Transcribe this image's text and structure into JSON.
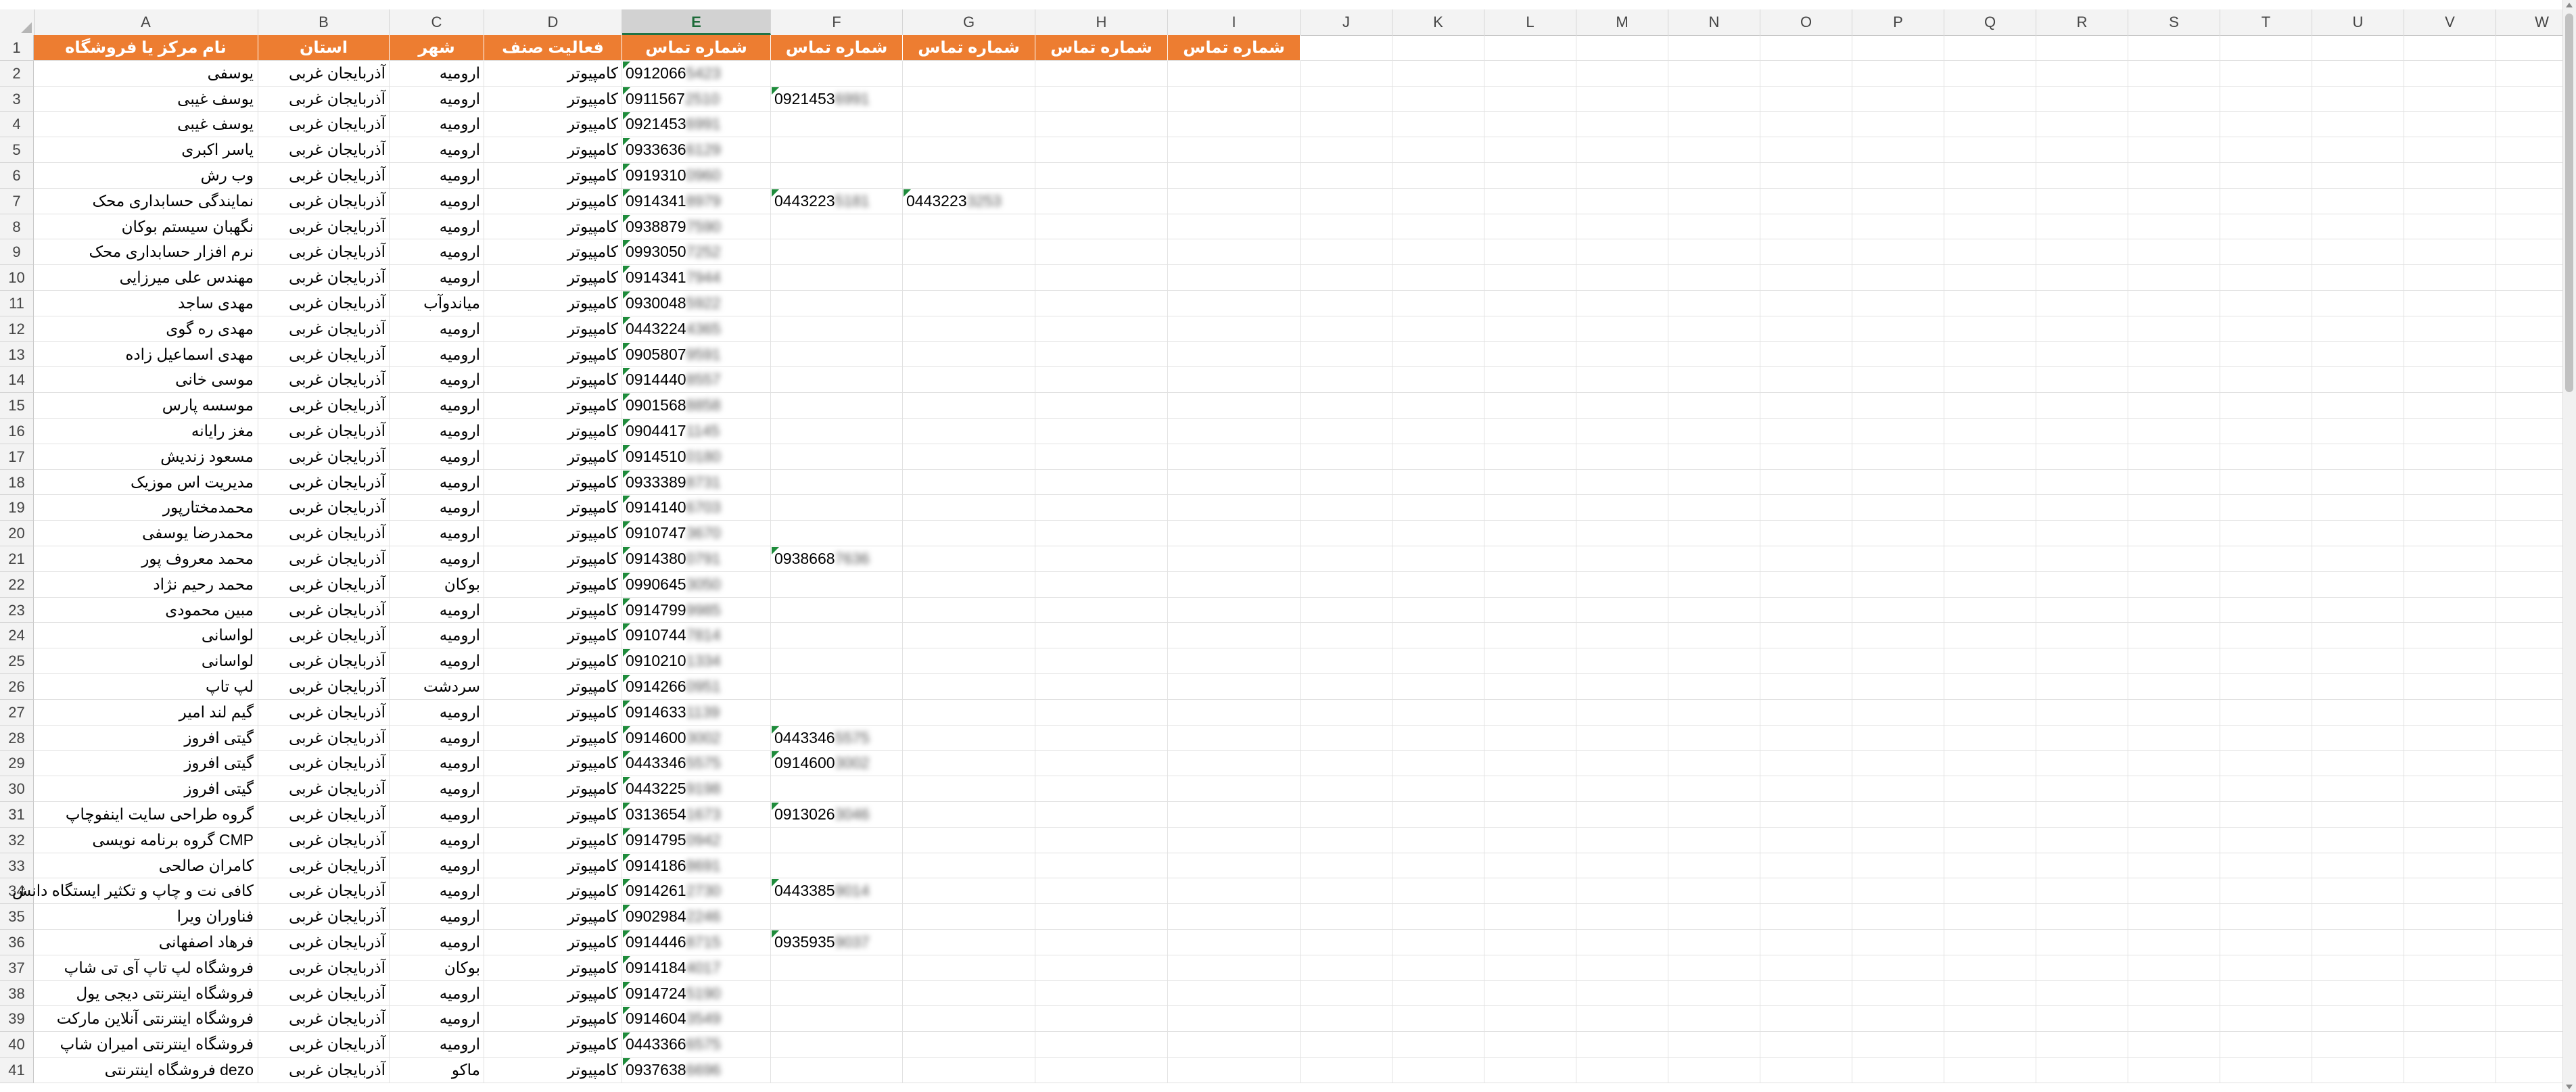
{
  "columns": [
    "A",
    "B",
    "C",
    "D",
    "E",
    "F",
    "G",
    "H",
    "I",
    "J",
    "K",
    "L",
    "M",
    "N",
    "O",
    "P",
    "Q",
    "R",
    "S",
    "T",
    "U",
    "V",
    "W"
  ],
  "selected_column": "E",
  "header_row": {
    "A": "نام مرکز یا فروشگاه",
    "B": "استان",
    "C": "شهر",
    "D": "فعالیت صنف",
    "E": "شماره تماس",
    "F": "شماره تماس",
    "G": "شماره تماس",
    "H": "شماره تماس",
    "I": "شماره تماس"
  },
  "rows": [
    {
      "n": "2",
      "A": "یوسفی",
      "B": "آذربایجان غربی",
      "C": "ارومیه",
      "D": "کامپیوتر",
      "E": "0912066",
      "Eb": "5423"
    },
    {
      "n": "3",
      "A": "یوسف غیبی",
      "B": "آذربایجان غربی",
      "C": "ارومیه",
      "D": "کامپیوتر",
      "E": "0911567",
      "Eb": "2510",
      "F": "0921453",
      "Fb": "6991"
    },
    {
      "n": "4",
      "A": "یوسف غیبی",
      "B": "آذربایجان غربی",
      "C": "ارومیه",
      "D": "کامپیوتر",
      "E": "0921453",
      "Eb": "6991"
    },
    {
      "n": "5",
      "A": "یاسر اکبری",
      "B": "آذربایجان غربی",
      "C": "ارومیه",
      "D": "کامپیوتر",
      "E": "0933636",
      "Eb": "6129"
    },
    {
      "n": "6",
      "A": "وب رش",
      "B": "آذربایجان غربی",
      "C": "ارومیه",
      "D": "کامپیوتر",
      "E": "0919310",
      "Eb": "0960"
    },
    {
      "n": "7",
      "A": "نمایندگی حسابداری محک",
      "B": "آذربایجان غربی",
      "C": "ارومیه",
      "D": "کامپیوتر",
      "E": "0914341",
      "Eb": "8979",
      "F": "0443223",
      "Fb": "5181",
      "G": "0443223",
      "Gb": "3253"
    },
    {
      "n": "8",
      "A": "نگهبان سیستم بوکان",
      "B": "آذربایجان غربی",
      "C": "ارومیه",
      "D": "کامپیوتر",
      "E": "0938879",
      "Eb": "7590"
    },
    {
      "n": "9",
      "A": "نرم افزار حسابداری محک",
      "B": "آذربایجان غربی",
      "C": "ارومیه",
      "D": "کامپیوتر",
      "E": "0993050",
      "Eb": "7252"
    },
    {
      "n": "10",
      "A": "مهندس علی میرزایی",
      "B": "آذربایجان غربی",
      "C": "ارومیه",
      "D": "کامپیوتر",
      "E": "0914341",
      "Eb": "7944"
    },
    {
      "n": "11",
      "A": "مهدی ساجد",
      "B": "آذربایجان غربی",
      "C": "میاندوآب",
      "D": "کامپیوتر",
      "E": "0930048",
      "Eb": "5922"
    },
    {
      "n": "12",
      "A": "مهدی ره گوی",
      "B": "آذربایجان غربی",
      "C": "ارومیه",
      "D": "کامپیوتر",
      "E": "0443224",
      "Eb": "4365"
    },
    {
      "n": "13",
      "A": "مهدی اسماعیل زاده",
      "B": "آذربایجان غربی",
      "C": "ارومیه",
      "D": "کامپیوتر",
      "E": "0905807",
      "Eb": "9591"
    },
    {
      "n": "14",
      "A": "موسی خانی",
      "B": "آذربایجان غربی",
      "C": "ارومیه",
      "D": "کامپیوتر",
      "E": "0914440",
      "Eb": "8557"
    },
    {
      "n": "15",
      "A": "موسسه پارس",
      "B": "آذربایجان غربی",
      "C": "ارومیه",
      "D": "کامپیوتر",
      "E": "0901568",
      "Eb": "8858"
    },
    {
      "n": "16",
      "A": "مغز رایانه",
      "B": "آذربایجان غربی",
      "C": "ارومیه",
      "D": "کامپیوتر",
      "E": "0904417",
      "Eb": "1145"
    },
    {
      "n": "17",
      "A": "مسعود زندیش",
      "B": "آذربایجان غربی",
      "C": "ارومیه",
      "D": "کامپیوتر",
      "E": "0914510",
      "Eb": "0180"
    },
    {
      "n": "18",
      "A": "مدیریت اس موزیک",
      "B": "آذربایجان غربی",
      "C": "ارومیه",
      "D": "کامپیوتر",
      "E": "0933389",
      "Eb": "8731"
    },
    {
      "n": "19",
      "A": "محمدمختارپور",
      "B": "آذربایجان غربی",
      "C": "ارومیه",
      "D": "کامپیوتر",
      "E": "0914140",
      "Eb": "6703"
    },
    {
      "n": "20",
      "A": "محمدرضا یوسفی",
      "B": "آذربایجان غربی",
      "C": "ارومیه",
      "D": "کامپیوتر",
      "E": "0910747",
      "Eb": "3670"
    },
    {
      "n": "21",
      "A": "محمد معروف پور",
      "B": "آذربایجان غربی",
      "C": "ارومیه",
      "D": "کامپیوتر",
      "E": "0914380",
      "Eb": "0791",
      "F": "0938668",
      "Fb": "7636"
    },
    {
      "n": "22",
      "A": "محمد رحیم نژاد",
      "B": "آذربایجان غربی",
      "C": "بوکان",
      "D": "کامپیوتر",
      "E": "0990645",
      "Eb": "3050"
    },
    {
      "n": "23",
      "A": "مبین محمودی",
      "B": "آذربایجان غربی",
      "C": "ارومیه",
      "D": "کامپیوتر",
      "E": "0914799",
      "Eb": "9985"
    },
    {
      "n": "24",
      "A": "لواسانی",
      "B": "آذربایجان غربی",
      "C": "ارومیه",
      "D": "کامپیوتر",
      "E": "0910744",
      "Eb": "7814"
    },
    {
      "n": "25",
      "A": "لواسانی",
      "B": "آذربایجان غربی",
      "C": "ارومیه",
      "D": "کامپیوتر",
      "E": "0910210",
      "Eb": "1334"
    },
    {
      "n": "26",
      "A": "لپ تاپ",
      "B": "آذربایجان غربی",
      "C": "سردشت",
      "D": "کامپیوتر",
      "E": "0914266",
      "Eb": "0951"
    },
    {
      "n": "27",
      "A": "گیم لند امیر",
      "B": "آذربایجان غربی",
      "C": "ارومیه",
      "D": "کامپیوتر",
      "E": "0914633",
      "Eb": "1139"
    },
    {
      "n": "28",
      "A": "گیتی افروز",
      "B": "آذربایجان غربی",
      "C": "ارومیه",
      "D": "کامپیوتر",
      "E": "0914600",
      "Eb": "3002",
      "F": "0443346",
      "Fb": "5575"
    },
    {
      "n": "29",
      "A": "گیتی افروز",
      "B": "آذربایجان غربی",
      "C": "ارومیه",
      "D": "کامپیوتر",
      "E": "0443346",
      "Eb": "5575",
      "F": "0914600",
      "Fb": "3002"
    },
    {
      "n": "30",
      "A": "گیتی افروز",
      "B": "آذربایجان غربی",
      "C": "ارومیه",
      "D": "کامپیوتر",
      "E": "0443225",
      "Eb": "9198"
    },
    {
      "n": "31",
      "A": "گروه طراحی سایت اینفوچاپ",
      "B": "آذربایجان غربی",
      "C": "ارومیه",
      "D": "کامپیوتر",
      "E": "0313654",
      "Eb": "1673",
      "F": "0913026",
      "Fb": "3046"
    },
    {
      "n": "32",
      "A": "گروه برنامه نویسی CMP",
      "B": "آذربایجان غربی",
      "C": "ارومیه",
      "D": "کامپیوتر",
      "E": "0914795",
      "Eb": "0942"
    },
    {
      "n": "33",
      "A": "کامران صالحی",
      "B": "آذربایجان غربی",
      "C": "ارومیه",
      "D": "کامپیوتر",
      "E": "0914186",
      "Eb": "8691"
    },
    {
      "n": "34",
      "A": "کافی نت و چاپ و تکثیر ایستگاه دانش",
      "B": "آذربایجان غربی",
      "C": "ارومیه",
      "D": "کامپیوتر",
      "E": "0914261",
      "Eb": "2730",
      "F": "0443385",
      "Fb": "9014"
    },
    {
      "n": "35",
      "A": "فناوران ویرا",
      "B": "آذربایجان غربی",
      "C": "ارومیه",
      "D": "کامپیوتر",
      "E": "0902984",
      "Eb": "2246"
    },
    {
      "n": "36",
      "A": "فرهاد اصفهانی",
      "B": "آذربایجان غربی",
      "C": "ارومیه",
      "D": "کامپیوتر",
      "E": "0914446",
      "Eb": "8715",
      "F": "0935935",
      "Fb": "9037"
    },
    {
      "n": "37",
      "A": "فروشگاه لپ تاپ آی تی شاپ",
      "B": "آذربایجان غربی",
      "C": "بوکان",
      "D": "کامپیوتر",
      "E": "0914184",
      "Eb": "4017"
    },
    {
      "n": "38",
      "A": "فروشگاه اینترنتی دیجی یول",
      "B": "آذربایجان غربی",
      "C": "ارومیه",
      "D": "کامپیوتر",
      "E": "0914724",
      "Eb": "5190"
    },
    {
      "n": "39",
      "A": "فروشگاه اینترنتی آنلاین مارکت",
      "B": "آذربایجان غربی",
      "C": "ارومیه",
      "D": "کامپیوتر",
      "E": "0914604",
      "Eb": "3549"
    },
    {
      "n": "40",
      "A": "فروشگاه اینترنتی امیران شاپ",
      "B": "آذربایجان غربی",
      "C": "ارومیه",
      "D": "کامپیوتر",
      "E": "0443366",
      "Eb": "6575"
    },
    {
      "n": "41",
      "A": "فروشگاه اینترنتی dezo",
      "B": "آذربایجان غربی",
      "C": "ماکو",
      "D": "کامپیوتر",
      "E": "0937638",
      "Eb": "6696"
    }
  ],
  "colors": {
    "header_fill": "#ed7d31",
    "header_text": "#ffffff",
    "error_triangle": "#1e8b3b",
    "selected_col_accent": "#217346"
  }
}
